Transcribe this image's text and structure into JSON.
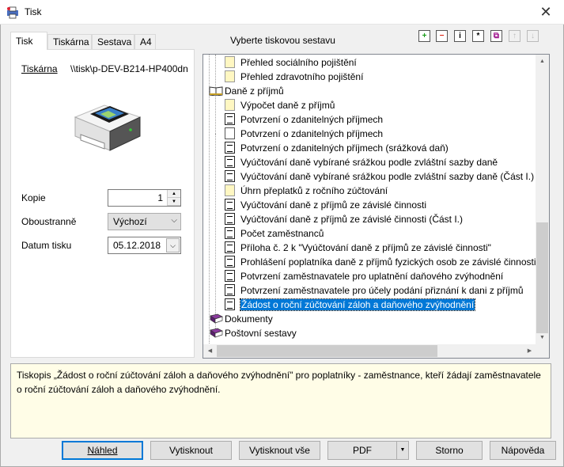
{
  "window": {
    "title": "Tisk"
  },
  "tabs": [
    {
      "label": "Tisk"
    },
    {
      "label": "Tiskárna"
    },
    {
      "label": "Sestava"
    },
    {
      "label": "A4"
    }
  ],
  "printer": {
    "label": "Tiskárna",
    "value": "\\\\tisk\\p-DEV-B214-HP400dn"
  },
  "copies": {
    "label": "Kopie",
    "value": "1"
  },
  "duplex": {
    "label": "Oboustranně",
    "value": "Výchozí"
  },
  "print_date": {
    "label": "Datum tisku",
    "value": "05.12.2018"
  },
  "report_header": "Vyberte tiskovou sestavu",
  "toolbar": [
    {
      "icon": "add-icon",
      "glyph": "+"
    },
    {
      "icon": "remove-icon",
      "glyph": "−"
    },
    {
      "icon": "info-icon",
      "glyph": "i"
    },
    {
      "icon": "star-icon",
      "glyph": "*"
    },
    {
      "icon": "copy-icon",
      "glyph": "⧉"
    },
    {
      "icon": "move-up-icon",
      "glyph": "↑"
    },
    {
      "icon": "move-down-icon",
      "glyph": "↓"
    }
  ],
  "tree": [
    {
      "label": "Přehled sociálního pojištění",
      "icon": "doc-yellow",
      "level": 2
    },
    {
      "label": "Přehled zdravotního pojištění",
      "icon": "doc-yellow",
      "level": 2
    },
    {
      "label": "Daně z příjmů",
      "icon": "book-open",
      "level": 1
    },
    {
      "label": "Výpočet daně z příjmů",
      "icon": "doc-yellow",
      "level": 2
    },
    {
      "label": "Potvrzení o zdanitelných příjmech",
      "icon": "doc-black",
      "level": 2
    },
    {
      "label": "Potvrzení o zdanitelných příjmech",
      "icon": "doc-white",
      "level": 2
    },
    {
      "label": "Potvrzení o zdanitelných příjmech (srážková daň)",
      "icon": "doc-black",
      "level": 2
    },
    {
      "label": "Vyúčtování daně vybírané srážkou podle zvláštní sazby daně",
      "icon": "doc-black",
      "level": 2
    },
    {
      "label": "Vyúčtování daně vybírané srážkou podle zvláštní sazby daně (Část I.)",
      "icon": "doc-black",
      "level": 2
    },
    {
      "label": "Úhrn přeplatků z ročního zúčtování",
      "icon": "doc-yellow",
      "level": 2
    },
    {
      "label": "Vyúčtování daně z příjmů ze závislé činnosti",
      "icon": "doc-black",
      "level": 2
    },
    {
      "label": "Vyúčtování daně z příjmů ze závislé činnosti (Část I.)",
      "icon": "doc-black",
      "level": 2
    },
    {
      "label": "Počet zaměstnanců",
      "icon": "doc-black",
      "level": 2
    },
    {
      "label": "Příloha č. 2 k \"Vyúčtování daně z příjmů ze závislé činnosti\"",
      "icon": "doc-black",
      "level": 2
    },
    {
      "label": "Prohlášení poplatníka daně z příjmů fyzických osob ze závislé činnosti",
      "icon": "doc-black",
      "level": 2
    },
    {
      "label": "Potvrzení zaměstnavatele pro uplatnění daňového zvýhodnění",
      "icon": "doc-black",
      "level": 2
    },
    {
      "label": "Potvrzení zaměstnavatele pro účely podání přiznání k dani z příjmů",
      "icon": "doc-black",
      "level": 2
    },
    {
      "label": "Žádost o roční zúčtování záloh a daňového zvýhodnění",
      "icon": "doc-black",
      "level": 2,
      "selected": true
    },
    {
      "label": "Dokumenty",
      "icon": "book-closed",
      "level": 1
    },
    {
      "label": "Poštovní sestavy",
      "icon": "book-closed",
      "level": 1
    }
  ],
  "description": "Tiskopis „Žádost o roční zúčtování záloh a daňového zvýhodnění\" pro poplatníky - zaměstnance, kteří žádají zaměstnavatele o roční zúčtování záloh a daňového zvýhodnění.",
  "buttons": {
    "preview": "Náhled",
    "print": "Vytisknout",
    "print_all": "Vytisknout vše",
    "pdf": "PDF",
    "cancel": "Storno",
    "help": "Nápověda"
  },
  "colors": {
    "accent": "#0078d7",
    "description_bg": "#fffde7",
    "selection": "#0078d7"
  }
}
